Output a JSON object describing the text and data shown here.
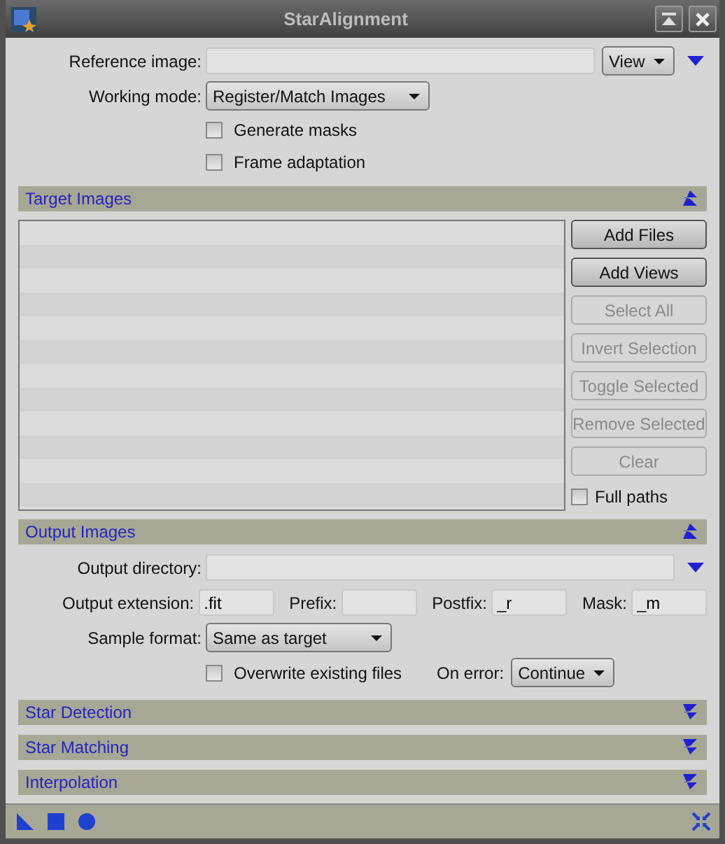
{
  "window": {
    "title": "StarAlignment"
  },
  "reference_image": {
    "label": "Reference image:",
    "mode": "View"
  },
  "working_mode": {
    "label": "Working mode:",
    "value": "Register/Match Images"
  },
  "options": [
    {
      "label": "Generate masks",
      "checked": false
    },
    {
      "label": "Frame adaptation",
      "checked": false
    }
  ],
  "target_images": {
    "title": "Target Images",
    "expanded": true,
    "buttons": [
      {
        "label": "Add Files",
        "disabled": false
      },
      {
        "label": "Add Views",
        "disabled": false
      },
      {
        "label": "Select All",
        "disabled": true
      },
      {
        "label": "Invert Selection",
        "disabled": true
      },
      {
        "label": "Toggle Selected",
        "disabled": true
      },
      {
        "label": "Remove Selected",
        "disabled": true
      },
      {
        "label": "Clear",
        "disabled": true
      }
    ],
    "full_paths": {
      "label": "Full paths",
      "checked": false
    }
  },
  "output_images": {
    "title": "Output Images",
    "expanded": true,
    "directory_label": "Output directory:",
    "fields": [
      {
        "label": "Output extension:",
        "value": ".fit"
      },
      {
        "label": "Prefix:"
      },
      {
        "label": "Postfix:",
        "value": "_r"
      },
      {
        "label": "Mask:",
        "value": "_m"
      }
    ],
    "sample_format_label": "Sample format:",
    "sample_format": "Same as target",
    "overwrite": {
      "label": "Overwrite existing files",
      "checked": false
    },
    "on_error_label": "On error:",
    "on_error": "Continue"
  },
  "collapsed_sections": [
    {
      "title": "Star Detection",
      "expanded": false
    },
    {
      "title": "Star Matching",
      "expanded": false
    },
    {
      "title": "Interpolation",
      "expanded": false
    }
  ]
}
